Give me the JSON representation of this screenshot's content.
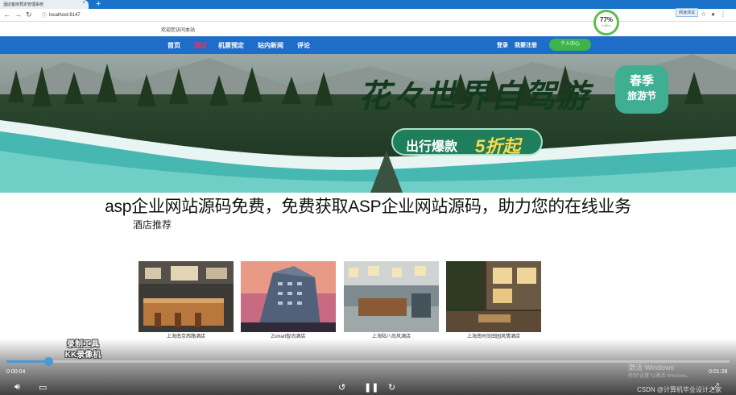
{
  "browser": {
    "tab_title": "酒店客房预定管理系统",
    "url": "localhost:6147",
    "speed_widget": {
      "percent": "77%",
      "sub": "4.8K/s"
    },
    "net_badge": "网速测试"
  },
  "site": {
    "welcome": "欢迎您访问本站",
    "nav": [
      "首页",
      "酒店",
      "机票预定",
      "站内新闻",
      "评论"
    ],
    "login": "登录",
    "register": "我要注册",
    "user_center": "个人中心"
  },
  "banner": {
    "headline": "花々世界自驾游",
    "promo": "出行爆款",
    "promo_discount": "5折起",
    "badge_top": "春季",
    "badge_bottom": "旅游节"
  },
  "overlay_title": "asp企业网站源码免费，免费获取ASP企业网站源码，助力您的在线业务",
  "section_title": "酒店推荐",
  "hotels": [
    {
      "name": "上海南京西路酒店"
    },
    {
      "name": "Zsmart智尚酒店"
    },
    {
      "name": "上海陆八尚风酒店"
    },
    {
      "name": "上海南时尚田园风情酒店"
    }
  ],
  "video": {
    "current_time": "0:00:04",
    "total_time": "0:01:28",
    "progress": 0.058,
    "watermark_line1": "录制工具",
    "watermark_line2": "KK录像机"
  },
  "windows_activation": {
    "title": "激活 Windows",
    "sub": "转到\"设置\"以激活 Windows。"
  },
  "csdn_mark": "CSDN @计算机毕业设计之家",
  "colors": {
    "nav_bg": "#1e6dc8",
    "active_nav": "#e8365d",
    "user_btn": "#3cb44b",
    "progress": "#4a9ad6"
  }
}
